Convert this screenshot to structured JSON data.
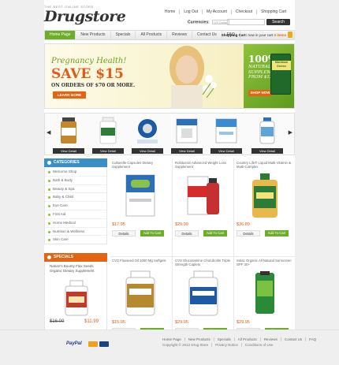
{
  "header": {
    "tagline": "The best online store",
    "logo": "Drugstore",
    "toplinks": [
      "Home",
      "Log Out",
      "My Account",
      "Checkout",
      "Shopping Cart"
    ],
    "currencies_label": "Currencies:",
    "currency_value": "US Dollar",
    "search_button": "Search"
  },
  "nav": {
    "items": [
      "Home Page",
      "New Products",
      "Specials",
      "All Products",
      "Reviews",
      "Contact Us",
      "FAQ"
    ],
    "cart_label": "Shopping Cart:",
    "cart_text": "now in your cart",
    "cart_items": "0 items"
  },
  "banner": {
    "left_headline": "Pregnancy Health!",
    "left_save": "SAVE $15",
    "left_sub": "ON ORDERS OF $70 OR MORE.",
    "left_button": "LEARN MORE",
    "right_big": "100%",
    "right_sub": "NATURAL SUPPLEMENT FROM $12.00",
    "right_button": "SHOP NOW",
    "right_product": "Maximum Greens"
  },
  "strip": {
    "view_detail": "View Detail",
    "colors": [
      "#c4862c",
      "#2f7c3a",
      "#1c5aa6",
      "#2a6fb8",
      "#3b8bd1",
      "#5fa4d8"
    ]
  },
  "sidebar": {
    "categories_title": "Categories",
    "categories": [
      "Welcome Shop",
      "Bath & Body",
      "Beauty & Spa",
      "Baby & Child",
      "Eye Care",
      "First Aid",
      "Home Medical",
      "Nutrition & Wellness",
      "Skin Care"
    ],
    "specials_title": "Specials",
    "special_name": "Nature's Bounty Flax Seeds Organic Dietary Supplement",
    "special_old": "$16.00",
    "special_new": "$11.99"
  },
  "products": [
    {
      "name": "Culturelle Capsules Dietary Supplement",
      "price": "$17.95",
      "color": "#2b6fb4"
    },
    {
      "name": "Robitussin Advanced Weight Loss Supplement",
      "price": "$29.99",
      "color": "#d52b2b"
    },
    {
      "name": "Country Life® Liquid Multi-Vitamin & Multi-Complex",
      "price": "$36.89",
      "color": "#2c7b37"
    },
    {
      "name": "CVS Flaxseed Oil 1000 Mg Softgels",
      "price": "$15.95",
      "color": "#b7892e"
    },
    {
      "name": "CVS Glucosamine Chondroitin Triple Strength Caplets",
      "price": "$29.95",
      "color": "#1c5aa6"
    },
    {
      "name": "Solac Organic All Natural Sunscreen SPF 30+",
      "price": "$29.95",
      "color": "#2b8a3a"
    }
  ],
  "buttons": {
    "details": "Details",
    "add_to_cart": "Add To Cart"
  },
  "footer": {
    "links": [
      "Home Page",
      "New Products",
      "Specials",
      "All Products",
      "Reviews",
      "Contact Us",
      "FAQ"
    ],
    "copyright": [
      "Copyright © 2012 Drug Store",
      "Privacy Notice",
      "Conditions of Use"
    ],
    "payment": "PayPal"
  },
  "colors": {
    "accent": "#6cad2a",
    "orange": "#e36412",
    "dark": "#333333"
  }
}
